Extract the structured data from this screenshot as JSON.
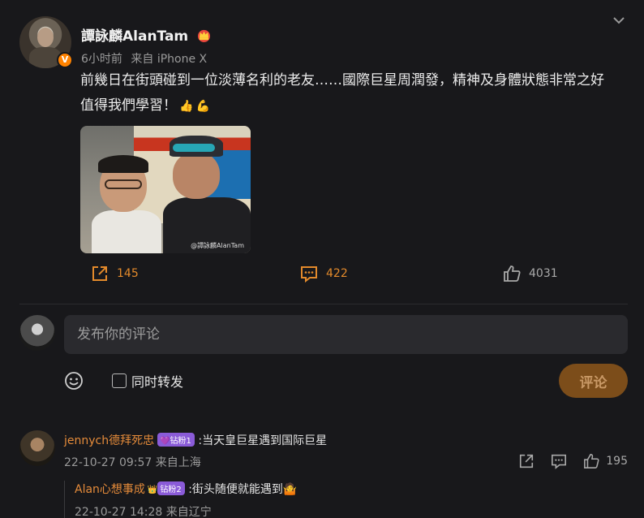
{
  "post": {
    "author": "譚詠麟AlanTam",
    "time": "6小时前",
    "source": "来自 iPhone X",
    "text_line1": "前幾日在街頭碰到一位淡薄名利的老友……國際巨星周潤發，精神及身體狀態非常之好",
    "text_line2": "值得我們學習！",
    "emoji_1": "👍",
    "emoji_2": "💪",
    "verified_mark": "V",
    "photo_watermark": "@譚詠麟AlanTam"
  },
  "actions": {
    "repost_count": "145",
    "comment_count": "422",
    "like_count": "4031"
  },
  "compose": {
    "placeholder": "发布你的评论",
    "repost_label": "同时转发",
    "submit_label": "评论"
  },
  "comments": [
    {
      "author": "jennych德拜死忠",
      "badge": "💜钻粉1",
      "text": ":当天皇巨星遇到国际巨星",
      "meta": "22-10-27 09:57 来自上海",
      "likes": "195"
    }
  ],
  "reply": {
    "author": "Alan心想事成",
    "badge": "钻粉2",
    "crown": "👑",
    "text": ":街头随便就能遇到",
    "emoji": "🤷",
    "meta": "22-10-27 14:28 来自辽宁"
  },
  "colors": {
    "background": "#18181b",
    "accent": "#e38a2b",
    "input_bg": "#2a2a2e",
    "submit_bg": "#7c4d1a"
  }
}
